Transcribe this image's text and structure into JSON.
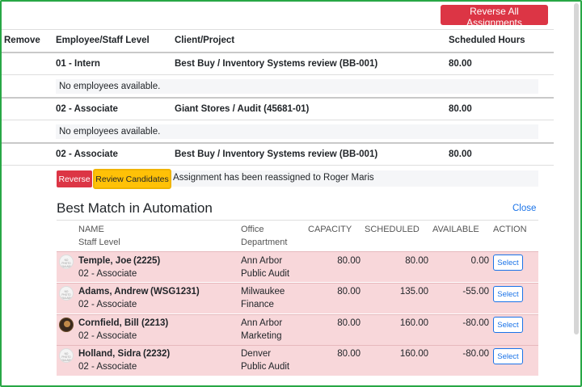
{
  "top": {
    "reverse_all_label": "Reverse All Assignments"
  },
  "table": {
    "headers": {
      "remove": "Remove",
      "employee_level": "Employee/Staff Level",
      "client_project": "Client/Project",
      "scheduled_hours": "Scheduled Hours"
    },
    "rows": [
      {
        "level": "01 - Intern",
        "project": "Best Buy / Inventory Systems review (BB-001)",
        "hours": "80.00",
        "note": "No employees available."
      },
      {
        "level": "02 - Associate",
        "project": "Giant Stores / Audit (45681-01)",
        "hours": "80.00",
        "note": "No employees available."
      },
      {
        "level": "02 - Associate",
        "project": "Best Buy / Inventory Systems review (BB-001)",
        "hours": "80.00"
      }
    ],
    "reverse_label": "Reverse",
    "review_label": "Review Candidates",
    "reassign_message": "Assignment has been reassigned to Roger Maris"
  },
  "match": {
    "title": "Best Match in Automation",
    "close_label": "Close",
    "headers": {
      "name": "NAME",
      "staff_level": "Staff Level",
      "office": "Office",
      "department": "Department",
      "capacity": "CAPACITY",
      "scheduled": "SCHEDULED",
      "available": "AVAILABLE",
      "action": "ACTION"
    },
    "placeholder_avatar_text": "NO PHOTO AVAILABLE",
    "select_label": "Select",
    "candidates": [
      {
        "name": "Temple, Joe",
        "id": "(2225)",
        "level": "02 - Associate",
        "office": "Ann Arbor",
        "department": "Public Audit",
        "capacity": "80.00",
        "scheduled": "80.00",
        "available": "0.00",
        "avatar": "placeholder"
      },
      {
        "name": "Adams, Andrew",
        "id": "(WSG1231)",
        "level": "02 - Associate",
        "office": "Milwaukee",
        "department": "Finance",
        "capacity": "80.00",
        "scheduled": "135.00",
        "available": "-55.00",
        "avatar": "placeholder"
      },
      {
        "name": "Cornfield, Bill",
        "id": "(2213)",
        "level": "02 - Associate",
        "office": "Ann Arbor",
        "department": "Marketing",
        "capacity": "80.00",
        "scheduled": "160.00",
        "available": "-80.00",
        "avatar": "photo"
      },
      {
        "name": "Holland, Sidra",
        "id": "(2232)",
        "level": "02 - Associate",
        "office": "Denver",
        "department": "Public Audit",
        "capacity": "80.00",
        "scheduled": "160.00",
        "available": "-80.00",
        "avatar": "placeholder"
      }
    ]
  },
  "colors": {
    "danger": "#dc3545",
    "warning": "#ffc107",
    "link": "#1a73e8",
    "row_highlight": "#f8d7da",
    "frame": "#28a745"
  }
}
